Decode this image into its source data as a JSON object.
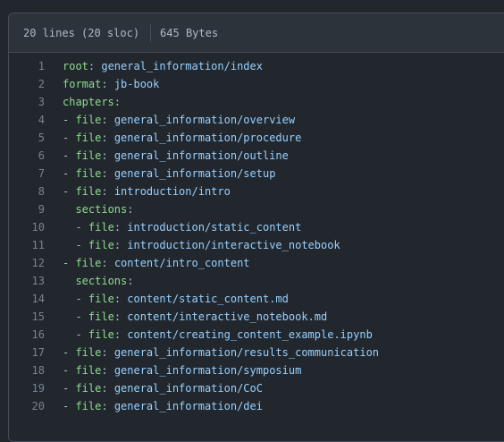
{
  "header": {
    "lines_info": "20 lines (20 sloc)",
    "size": "645 Bytes"
  },
  "lines": [
    {
      "num": "1",
      "indent": "",
      "dash": "",
      "key": "root",
      "value": "general_information/index"
    },
    {
      "num": "2",
      "indent": "",
      "dash": "",
      "key": "format",
      "value": "jb-book"
    },
    {
      "num": "3",
      "indent": "",
      "dash": "",
      "key": "chapters",
      "value": ""
    },
    {
      "num": "4",
      "indent": "",
      "dash": "- ",
      "key": "file",
      "value": "general_information/overview"
    },
    {
      "num": "5",
      "indent": "",
      "dash": "- ",
      "key": "file",
      "value": "general_information/procedure"
    },
    {
      "num": "6",
      "indent": "",
      "dash": "- ",
      "key": "file",
      "value": "general_information/outline"
    },
    {
      "num": "7",
      "indent": "",
      "dash": "- ",
      "key": "file",
      "value": "general_information/setup"
    },
    {
      "num": "8",
      "indent": "",
      "dash": "- ",
      "key": "file",
      "value": "introduction/intro"
    },
    {
      "num": "9",
      "indent": "  ",
      "dash": "",
      "key": "sections",
      "value": ""
    },
    {
      "num": "10",
      "indent": "  ",
      "dash": "- ",
      "key": "file",
      "value": "introduction/static_content"
    },
    {
      "num": "11",
      "indent": "  ",
      "dash": "- ",
      "key": "file",
      "value": "introduction/interactive_notebook"
    },
    {
      "num": "12",
      "indent": "",
      "dash": "- ",
      "key": "file",
      "value": "content/intro_content"
    },
    {
      "num": "13",
      "indent": "  ",
      "dash": "",
      "key": "sections",
      "value": ""
    },
    {
      "num": "14",
      "indent": "  ",
      "dash": "- ",
      "key": "file",
      "value": "content/static_content.md"
    },
    {
      "num": "15",
      "indent": "  ",
      "dash": "- ",
      "key": "file",
      "value": "content/interactive_notebook.md"
    },
    {
      "num": "16",
      "indent": "  ",
      "dash": "- ",
      "key": "file",
      "value": "content/creating_content_example.ipynb"
    },
    {
      "num": "17",
      "indent": "",
      "dash": "- ",
      "key": "file",
      "value": "general_information/results_communication"
    },
    {
      "num": "18",
      "indent": "",
      "dash": "- ",
      "key": "file",
      "value": "general_information/symposium"
    },
    {
      "num": "19",
      "indent": "",
      "dash": "- ",
      "key": "file",
      "value": "general_information/CoC"
    },
    {
      "num": "20",
      "indent": "",
      "dash": "- ",
      "key": "file",
      "value": "general_information/dei"
    }
  ]
}
